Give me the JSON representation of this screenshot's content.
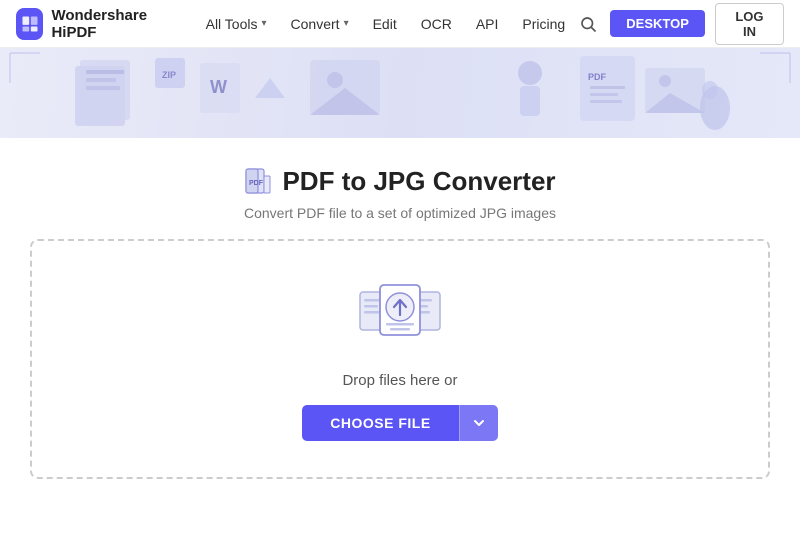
{
  "brand": {
    "name": "Wondershare HiPDF",
    "logo_color": "#5a55f4"
  },
  "nav": {
    "all_tools": "All Tools",
    "convert": "Convert",
    "edit": "Edit",
    "ocr": "OCR",
    "api": "API",
    "pricing": "Pricing",
    "desktop_btn": "DESKTOP",
    "login_btn": "LOG IN"
  },
  "page": {
    "title": "PDF to JPG Converter",
    "subtitle": "Convert PDF file to a set of optimized JPG images",
    "drop_text": "Drop files here or",
    "choose_file_btn": "CHOOSE FILE"
  }
}
